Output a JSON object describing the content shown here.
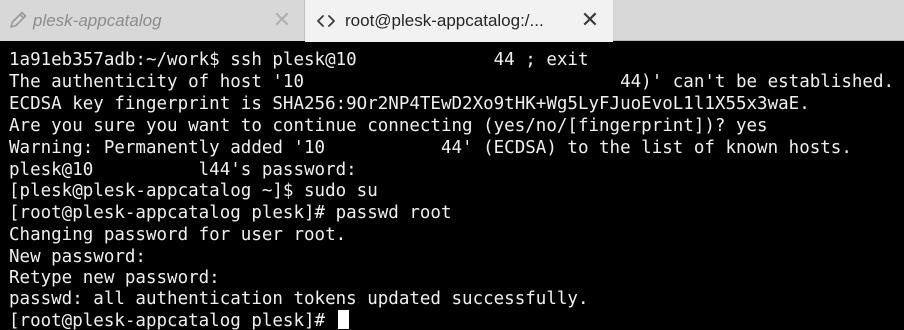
{
  "tabs": [
    {
      "title": "plesk-appcatalog",
      "icon": "pen-icon",
      "active": false,
      "close": "✕"
    },
    {
      "title": "root@plesk-appcatalog:/...",
      "icon": "terminal-code-icon",
      "active": true,
      "close": "✕"
    }
  ],
  "terminal": {
    "lines": [
      "1a91eb357adb:~/work$ ssh plesk@10             44 ; exit",
      "The authenticity of host '10                              44)' can't be established.",
      "ECDSA key fingerprint is SHA256:9Or2NP4TEwD2Xo9tHK+Wg5LyFJuoEvoL1l1X55x3waE.",
      "Are you sure you want to continue connecting (yes/no/[fingerprint])? yes",
      "Warning: Permanently added '10           44' (ECDSA) to the list of known hosts.",
      "plesk@10          l44's password:",
      "[plesk@plesk-appcatalog ~]$ sudo su",
      "[root@plesk-appcatalog plesk]# passwd root",
      "Changing password for user root.",
      "New password:",
      "Retype new password:",
      "passwd: all authentication tokens updated successfully.",
      "[root@plesk-appcatalog plesk]# "
    ]
  },
  "colors": {
    "terminal_bg": "#000000",
    "terminal_fg": "#f0f0f0",
    "tabbar_bg": "#d8d8d8",
    "active_tab_bg": "#f2f2f2"
  }
}
